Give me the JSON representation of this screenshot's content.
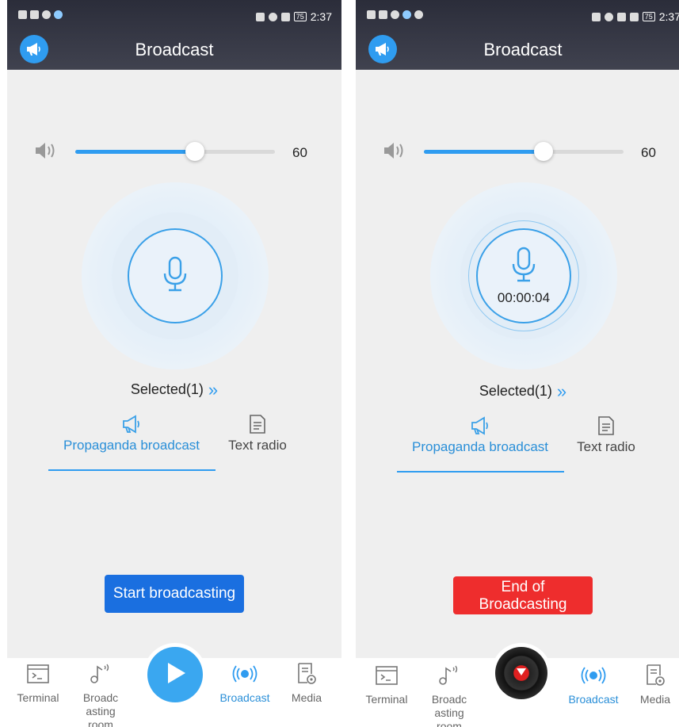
{
  "colors": {
    "accent": "#2f9cf0",
    "start_button": "#1a6fe0",
    "end_button": "#ee2d2d",
    "header": "#2b2d3a"
  },
  "screens": [
    {
      "status": {
        "time": "2:37",
        "battery": "75"
      },
      "header": {
        "title": "Broadcast",
        "icon": "megaphone-icon"
      },
      "volume": {
        "value": "60",
        "level": 0.6
      },
      "selected": {
        "label": "Selected(1)"
      },
      "tabs": [
        {
          "label": "Propaganda broadcast",
          "icon": "megaphone-icon",
          "active": true
        },
        {
          "label": "Text radio",
          "icon": "document-icon"
        }
      ],
      "action": {
        "label": "Start broadcasting"
      },
      "nav": [
        {
          "label": "Terminal",
          "icon": "terminal-icon"
        },
        {
          "label": "Broadc\nasting\nroom",
          "icon": "music-note-icon"
        },
        {
          "label": "Broadcast",
          "icon": "broadcast-icon",
          "active": true
        },
        {
          "label": "Media",
          "icon": "media-file-icon"
        }
      ],
      "center": {
        "icon": "play-icon"
      }
    },
    {
      "status": {
        "time": "2:37",
        "battery": "75"
      },
      "header": {
        "title": "Broadcast",
        "icon": "megaphone-icon"
      },
      "volume": {
        "value": "60",
        "level": 0.6
      },
      "mic": {
        "timer": "00:00:04"
      },
      "selected": {
        "label": "Selected(1)"
      },
      "tabs": [
        {
          "label": "Propaganda broadcast",
          "icon": "megaphone-icon",
          "active": true
        },
        {
          "label": "Text radio",
          "icon": "document-icon"
        }
      ],
      "action": {
        "label": "End of\nBroadcasting"
      },
      "nav": [
        {
          "label": "Terminal",
          "icon": "terminal-icon"
        },
        {
          "label": "Broadc\nasting\nroom",
          "icon": "music-note-icon"
        },
        {
          "label": "Broadcast",
          "icon": "broadcast-icon",
          "active": true
        },
        {
          "label": "Media",
          "icon": "media-file-icon"
        }
      ],
      "center": {
        "icon": "vinyl-disc-icon"
      }
    }
  ]
}
